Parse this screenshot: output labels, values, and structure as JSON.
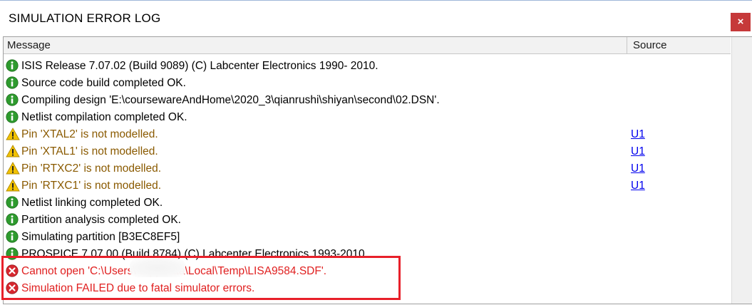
{
  "window": {
    "title": "SIMULATION ERROR LOG",
    "close_glyph": "×"
  },
  "columns": {
    "message": "Message",
    "source": "Source"
  },
  "rows": [
    {
      "type": "info",
      "icon": "info-icon",
      "message": "ISIS Release 7.07.02 (Build 9089) (C) Labcenter Electronics 1990- 2010.",
      "source": ""
    },
    {
      "type": "info",
      "icon": "info-icon",
      "message": "Source code build completed OK.",
      "source": ""
    },
    {
      "type": "info",
      "icon": "info-icon",
      "message": "Compiling design 'E:\\coursewareAndHome\\2020_3\\qianrushi\\shiyan\\second\\02.DSN'.",
      "source": ""
    },
    {
      "type": "info",
      "icon": "info-icon",
      "message": "Netlist compilation completed OK.",
      "source": ""
    },
    {
      "type": "warn",
      "icon": "warning-icon",
      "message": "Pin 'XTAL2' is not modelled.",
      "source": "U1"
    },
    {
      "type": "warn",
      "icon": "warning-icon",
      "message": "Pin 'XTAL1' is not modelled.",
      "source": "U1"
    },
    {
      "type": "warn",
      "icon": "warning-icon",
      "message": "Pin 'RTXC2' is not modelled.",
      "source": "U1"
    },
    {
      "type": "warn",
      "icon": "warning-icon",
      "message": "Pin 'RTXC1' is not modelled.",
      "source": "U1"
    },
    {
      "type": "info",
      "icon": "info-icon",
      "message": "Netlist linking completed OK.",
      "source": ""
    },
    {
      "type": "info",
      "icon": "info-icon",
      "message": "Partition analysis completed OK.",
      "source": ""
    },
    {
      "type": "info",
      "icon": "info-icon",
      "message": "Simulating partition [B3EC8EF5]",
      "source": ""
    },
    {
      "type": "info",
      "icon": "info-icon",
      "message": "PROSPICE 7.07.00 (Build 8784) (C) Labcenter Electronics 1993-2010.",
      "source": ""
    },
    {
      "type": "err",
      "icon": "error-icon",
      "message": "Cannot open 'C:\\Users\\           \\AppData\\Local\\Temp\\LISA9584.SDF'.",
      "source": ""
    },
    {
      "type": "err",
      "icon": "error-icon",
      "message": "Simulation FAILED due to fatal simulator errors.",
      "source": ""
    }
  ],
  "colors": {
    "info": "#2e9b2e",
    "warn": "#f2c200",
    "err": "#d6272f",
    "highlight_box": "#e8202a"
  }
}
